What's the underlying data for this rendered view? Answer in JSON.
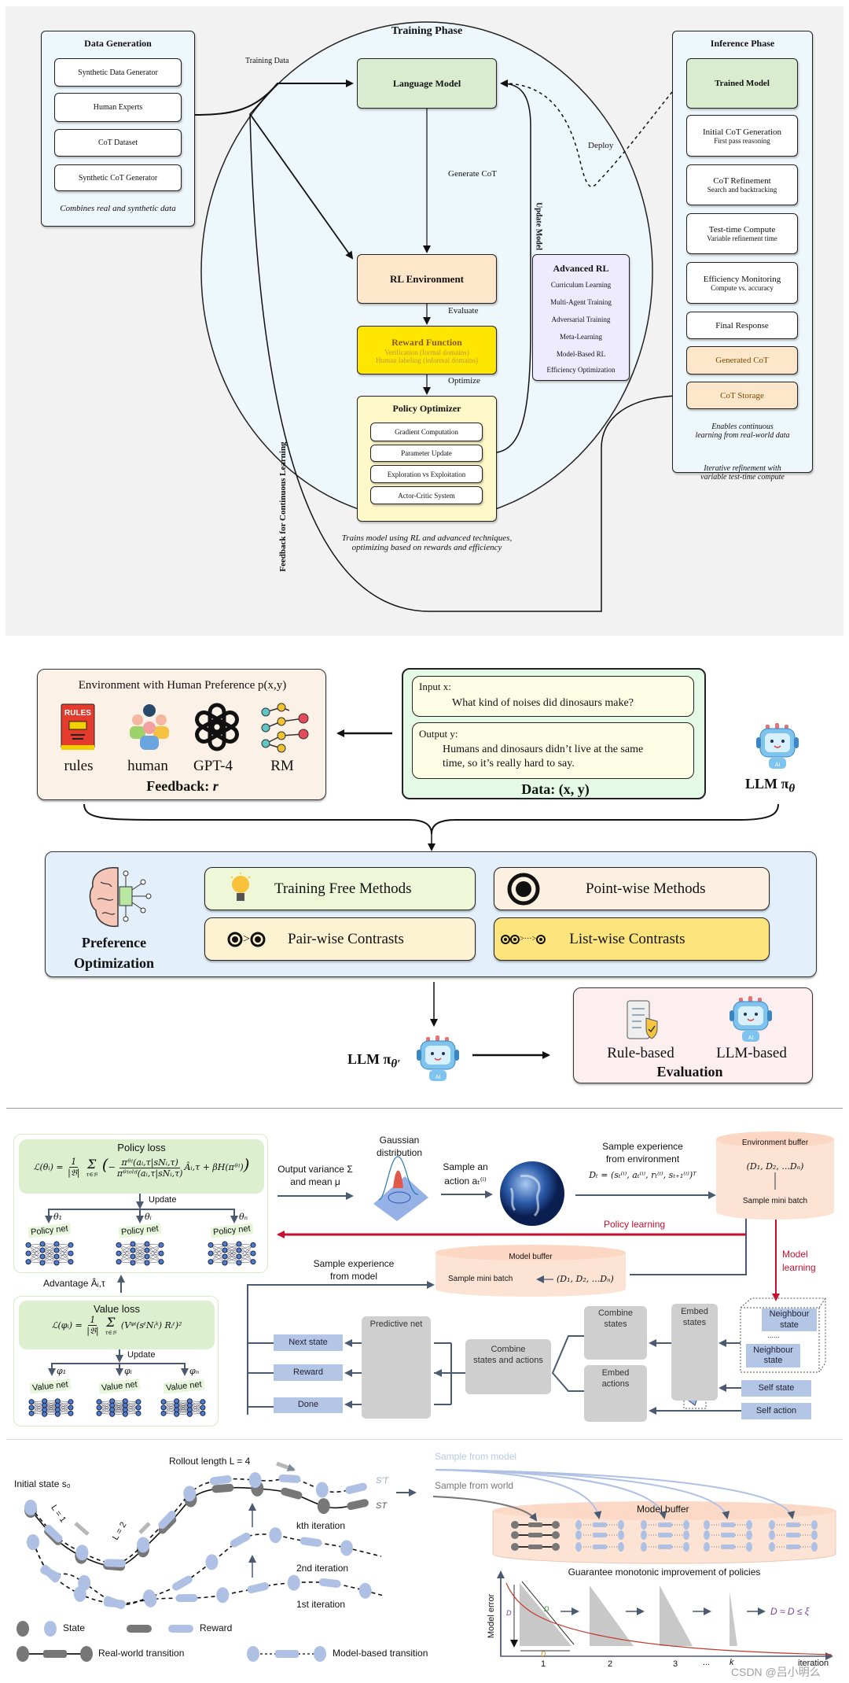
{
  "panel1": {
    "data_generation": {
      "title": "Data Generation",
      "items": [
        "Synthetic Data Generator",
        "Human Experts",
        "CoT Dataset",
        "Synthetic CoT Generator"
      ],
      "caption": "Combines real and synthetic data"
    },
    "training_phase": {
      "title": "Training Phase",
      "language_model": "Language Model",
      "rl_environment": "RL Environment",
      "reward_function": {
        "title": "Reward Function",
        "lines": [
          "Verification (formal domains)",
          "Human labeling (informal domains)"
        ]
      },
      "policy_optimizer": {
        "title": "Policy Optimizer",
        "items": [
          "Gradient Computation",
          "Parameter Update",
          "Exploration vs Exploitation",
          "Actor-Critic System"
        ]
      },
      "advanced_rl": {
        "title": "Advanced RL",
        "items": [
          "Curriculum Learning",
          "Multi-Agent Training",
          "Adversarial Training",
          "Meta-Learning",
          "Model-Based RL",
          "Efficiency Optimization"
        ]
      },
      "caption": [
        "Trains model using RL and advanced techniques,",
        "optimizing based on rewards and efficiency"
      ]
    },
    "edge_labels": {
      "training_data": "Training Data",
      "generate_cot": "Generate CoT",
      "evaluate": "Evaluate",
      "optimize": "Optimize",
      "update_model": "Update Model",
      "deploy": "Deploy",
      "feedback": "Feedback for Continuous Learning"
    },
    "inference_phase": {
      "title": "Inference Phase",
      "trained_model": "Trained Model",
      "steps": [
        {
          "title": "Initial CoT Generation",
          "sub": "First pass reasoning"
        },
        {
          "title": "CoT Refinement",
          "sub": "Search and backtracking"
        },
        {
          "title": "Test-time Compute",
          "sub": "Variable refinement time"
        },
        {
          "title": "Efficiency Monitoring",
          "sub": "Compute vs. accuracy"
        }
      ],
      "final_response": "Final Response",
      "generated_cot": "Generated CoT",
      "cot_storage": "CoT Storage",
      "caption": [
        "Enables continuous",
        "learning from real-world data"
      ],
      "caption2": [
        "Iterative refinement with",
        "variable test-time compute"
      ]
    },
    "colors": {
      "green": "#d9ecd0",
      "peach": "#fde6c9",
      "yellow": "#ffe600",
      "lavender": "#eeebff",
      "panel": "#eef7fc"
    }
  },
  "panel2": {
    "environment": {
      "title": "Environment with Human Preference p(x,y)",
      "sources": [
        {
          "label": "rules",
          "icon": "rules-book-icon"
        },
        {
          "label": "human",
          "icon": "people-icon"
        },
        {
          "label": "GPT-4",
          "icon": "openai-logo-icon"
        },
        {
          "label": "RM",
          "icon": "reward-model-network-icon"
        }
      ],
      "feedback_label": "Feedback:",
      "feedback_var": "r",
      "rules_icon_text": "RULES"
    },
    "data": {
      "input_label": "Input x:",
      "input_text": "What kind of noises did dinosaurs make?",
      "output_label": "Output y:",
      "output_text": [
        "Humans and dinosaurs didn’t live at the same",
        "time, so it’s really hard to say."
      ],
      "caption": "Data: (x, y)"
    },
    "llm": {
      "label": "LLM π",
      "sub": "θ"
    },
    "preference_optimization": {
      "title": [
        "Preference",
        "Optimization"
      ],
      "methods": [
        {
          "label": "Training Free Methods",
          "icon": "lightbulb-icon",
          "color": "#eef8d8"
        },
        {
          "label": "Point-wise Methods",
          "icon": "target-circle-icon",
          "color": "#fcf0e1"
        },
        {
          "label": "Pair-wise Contrasts",
          "icon": "pair-compare-icon",
          "color": "#fdf3d2",
          "icon_text": ">"
        },
        {
          "label": "List-wise Contrasts",
          "icon": "list-compare-icon",
          "color": "#fde47c",
          "icon_text": ">···>"
        }
      ]
    },
    "llm_updated": {
      "label": "LLM π",
      "sub": "θ′"
    },
    "evaluation": {
      "title": "Evaluation",
      "items": [
        {
          "label": "Rule-based",
          "icon": "rule-scroll-shield-icon"
        },
        {
          "label": "LLM-based",
          "icon": "robot-icon"
        }
      ]
    },
    "robot_badge": "AI"
  },
  "panel3": {
    "policy_loss": {
      "title": "Policy loss",
      "lhs": "ℒ(θᵢ) =",
      "coef_num": "1",
      "coef_den": "|𝔅|",
      "sum": "Σ",
      "sum_sub": "τ∈𝔅",
      "ratio_num": "πᶿⁱ(aᵢ,τ|sNᵢ,τ)",
      "ratio_den": "πᶿⁱᵒˡᵈ(aᵢ,τ|sNᵢ,τ)",
      "tail": "Âᵢ,τ + βH(πᶿⁱ)",
      "update": "Update",
      "params": [
        "θ₁",
        "θᵢ",
        "θₙ"
      ],
      "nets": [
        "Policy net",
        "Policy net",
        "Policy net"
      ]
    },
    "advantage": "Advantage Âᵢ,τ",
    "value_loss": {
      "title": "Value loss",
      "lhs": "ℒ(φᵢ) =",
      "coef_num": "1",
      "coef_den": "|𝔅|",
      "sum": "Σ",
      "sum_sub": "τ∈𝔅",
      "body": "(Vᵠⁱ(sᵗNᵢᵏ) Rᵢᵗ)²",
      "update": "Update",
      "params": [
        "φ₁",
        "φᵢ",
        "φₙ"
      ],
      "nets": [
        "Value net",
        "Value net",
        "Value net"
      ]
    },
    "output_variance": [
      "Output variance Σ",
      "and mean μ"
    ],
    "gaussian": [
      "Gaussian",
      "distribution"
    ],
    "sample_action": [
      "Sample an",
      "action aₜ⁽ⁱ⁾"
    ],
    "sample_env": [
      "Sample experience",
      "from environment"
    ],
    "experience_formula": "Dₜ = (sₜ⁽ⁱ⁾, aₜ⁽ⁱ⁾, rₜ⁽ⁱ⁾, sₜ₊₁⁽ⁱ⁾)ᵀ",
    "environment_buffer": {
      "title": "Environment buffer",
      "content": "(D₁, D₂, ...Dₙ)",
      "action": "Sample mini batch"
    },
    "policy_learning": "Policy learning",
    "model_learning": [
      "Model",
      "learning"
    ],
    "model_buffer": {
      "title": "Model buffer",
      "action": "Sample mini batch",
      "content": "(D₁, D₂, ...Dₙ)"
    },
    "sample_model": [
      "Sample experience",
      "from model"
    ],
    "outputs": [
      "Next state",
      "Reward",
      "Done"
    ],
    "predictive_net": "Predictive net",
    "combine_states_actions": [
      "Combine",
      "states and actions"
    ],
    "combine_states": [
      "Combine",
      "states"
    ],
    "embed_actions": [
      "Embed",
      "actions"
    ],
    "embed_states": [
      "Embed",
      "states"
    ],
    "inputs": {
      "neighbour_state": [
        "Neighbour",
        "state"
      ],
      "dots": "......",
      "self_state": "Self state",
      "self_action": "Self action"
    },
    "accent_red": "#c8102e"
  },
  "panel4": {
    "rollout_length": "Rollout length L = 4",
    "initial_state": "Initial state s₀",
    "l1": "L = 1",
    "l2": "L = 2",
    "s_t_prime": "S′T",
    "s_t": "ST",
    "iterations": [
      "kth iteration",
      "2nd iteration",
      "1st iteration"
    ],
    "legend": {
      "state": "State",
      "reward": "Reward",
      "real": "Real-world transition",
      "model": "Model-based transition"
    },
    "sample_from_model": "Sample from model",
    "sample_from_world": "Sample from world",
    "model_buffer": "Model buffer",
    "guarantee": "Guarantee monotonic improvement of policies",
    "chart": {
      "ylabel": "Model error",
      "xlabel": "iteration",
      "ticks": [
        "1",
        "2",
        "3",
        "...",
        "k"
      ],
      "bound_label": "D",
      "formula": "D ≈ D ≤ ξ"
    },
    "colors": {
      "state_blue": "#aec0e4",
      "real_gray": "#777777",
      "buffer": "#fde3d3",
      "error_curve": "#c0392b"
    }
  },
  "watermark": "CSDN @吕小明么"
}
